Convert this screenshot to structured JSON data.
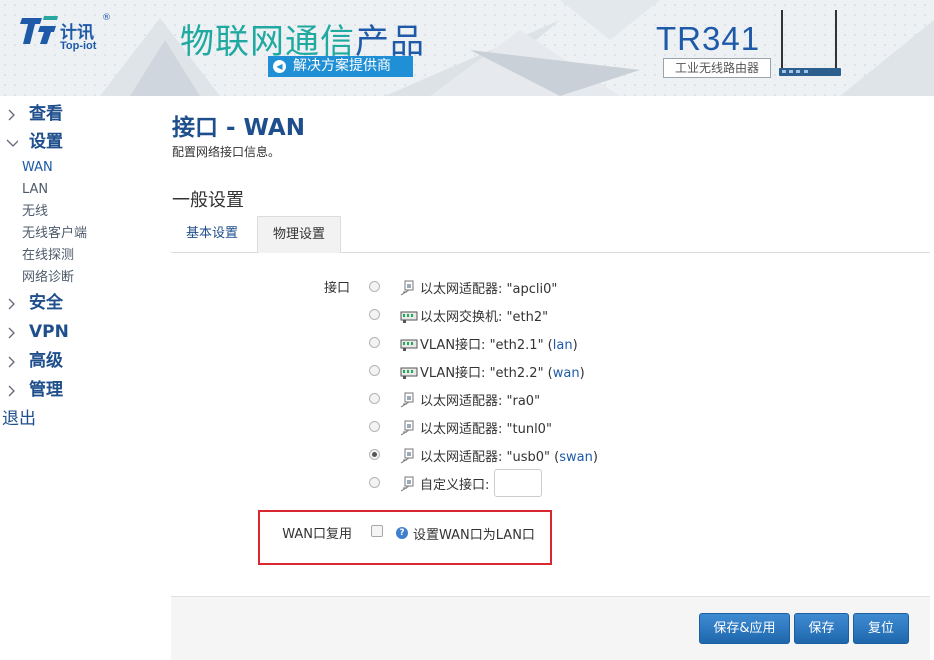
{
  "header": {
    "brand_cn": "计讯",
    "brand_reg": "®",
    "brand_en": "Top-iot",
    "slogan_part1": "物联网通信",
    "slogan_part2": "产品",
    "sub_slogan": "解决方案提供商",
    "model": "TR341",
    "model_sub": "工业无线路由器"
  },
  "menu": {
    "view": "查看",
    "settings": "设置",
    "settings_items": [
      "WAN",
      "LAN",
      "无线",
      "无线客户端",
      "在线探测",
      "网络诊断"
    ],
    "security": "安全",
    "vpn": "VPN",
    "advanced": "高级",
    "manage": "管理",
    "logout": "退出"
  },
  "main": {
    "title": "接口 - WAN",
    "description": "配置网络接口信息。",
    "section": "一般设置",
    "tabs": [
      "基本设置",
      "物理设置"
    ],
    "active_tab": 1,
    "interface_label": "接口",
    "interfaces": [
      {
        "prefix": "以太网适配器: ",
        "name": "\"apcli0\"",
        "net": "",
        "icon": "adapter-icon",
        "checked": false
      },
      {
        "prefix": "以太网交换机: ",
        "name": "\"eth2\"",
        "net": "",
        "icon": "switch-icon",
        "checked": false
      },
      {
        "prefix": "VLAN接口: ",
        "name": "\"eth2.1\"",
        "net": "lan",
        "icon": "switch-icon",
        "checked": false
      },
      {
        "prefix": "VLAN接口: ",
        "name": "\"eth2.2\"",
        "net": "wan",
        "icon": "switch-icon",
        "checked": false
      },
      {
        "prefix": "以太网适配器: ",
        "name": "\"ra0\"",
        "net": "",
        "icon": "adapter-icon",
        "checked": false
      },
      {
        "prefix": "以太网适配器: ",
        "name": "\"tunl0\"",
        "net": "",
        "icon": "adapter-icon",
        "checked": false
      },
      {
        "prefix": "以太网适配器: ",
        "name": "\"usb0\"",
        "net": "swan",
        "icon": "adapter-icon",
        "checked": true
      }
    ],
    "custom_interface_label": "自定义接口:",
    "custom_interface_value": "",
    "wan_reuse_label": "WAN口复用",
    "wan_reuse_help": "设置WAN口为LAN口",
    "wan_reuse_checked": false
  },
  "buttons": {
    "save_apply": "保存&应用",
    "save": "保存",
    "reset": "复位"
  },
  "colors": {
    "accent": "#1e4f8c",
    "button": "#2b78c2",
    "highlight_border": "#d9282f"
  }
}
